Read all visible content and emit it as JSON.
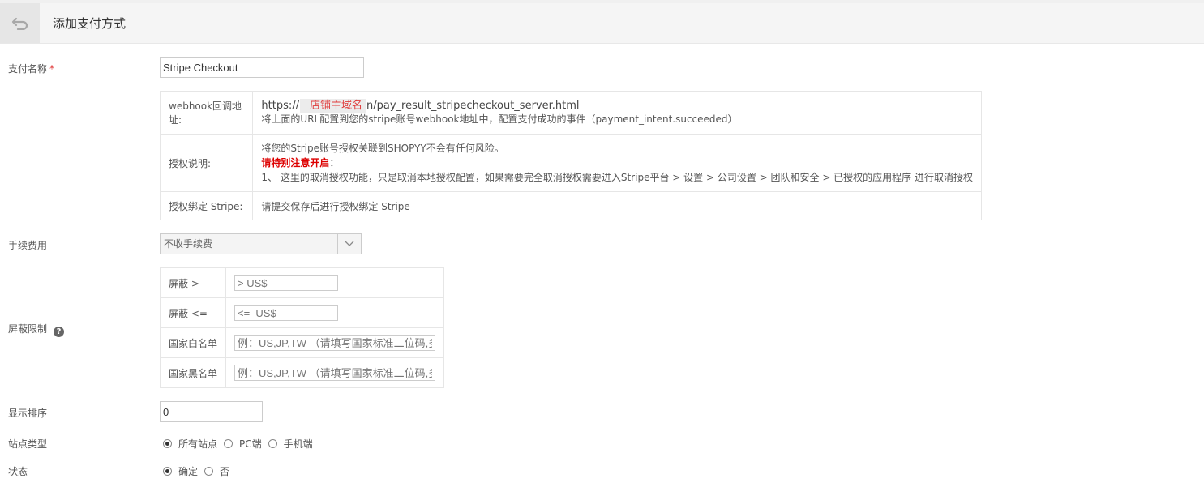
{
  "header": {
    "title": "添加支付方式",
    "back_icon": "undo-arrow-icon"
  },
  "form": {
    "payment_name": {
      "label": "支付名称",
      "required_mark": "*",
      "value": "Stripe Checkout"
    },
    "info": {
      "webhook": {
        "label": "webhook回调地址:",
        "url_prefix": "https://",
        "domain_mask": "店铺主域名",
        "url_suffix": "n/pay_result_stripecheckout_server.html",
        "note": "将上面的URL配置到您的stripe账号webhook地址中，配置支付成功的事件（payment_intent.succeeded）"
      },
      "auth_desc": {
        "label": "授权说明:",
        "line1": "将您的Stripe账号授权关联到SHOPYY不会有任何风险。",
        "warn": "请特别注意开启",
        "warn_suffix": "：",
        "line3": "1、 这里的取消授权功能，只是取消本地授权配置，如果需要完全取消授权需要进入Stripe平台 > 设置 > 公司设置 > 团队和安全 > 已授权的应用程序 进行取消授权"
      },
      "auth_bind": {
        "label": "授权绑定 Stripe:",
        "value": "请提交保存后进行授权绑定 Stripe"
      }
    },
    "fee": {
      "label": "手续费用",
      "selected": "不收手续费"
    },
    "shield": {
      "label": "屏蔽限制",
      "help_icon": "question-circle-icon",
      "gt": {
        "label": "屏蔽 >",
        "placeholder": "> US$"
      },
      "lte": {
        "label": "屏蔽 <=",
        "placeholder": "<=  US$"
      },
      "whitelist": {
        "label": "国家白名单",
        "placeholder": "例：US,JP,TW （请填写国家标准二位码,多个用英文逗号隔开）"
      },
      "blacklist": {
        "label": "国家黑名单",
        "placeholder": "例：US,JP,TW （请填写国家标准二位码,多个用英文逗号隔开）"
      }
    },
    "sort": {
      "label": "显示排序",
      "value": "0"
    },
    "site_type": {
      "label": "站点类型",
      "options": [
        "所有站点",
        "PC端",
        "手机端"
      ],
      "selected": "所有站点"
    },
    "status": {
      "label": "状态",
      "options": [
        "确定",
        "否"
      ],
      "selected": "确定"
    }
  }
}
